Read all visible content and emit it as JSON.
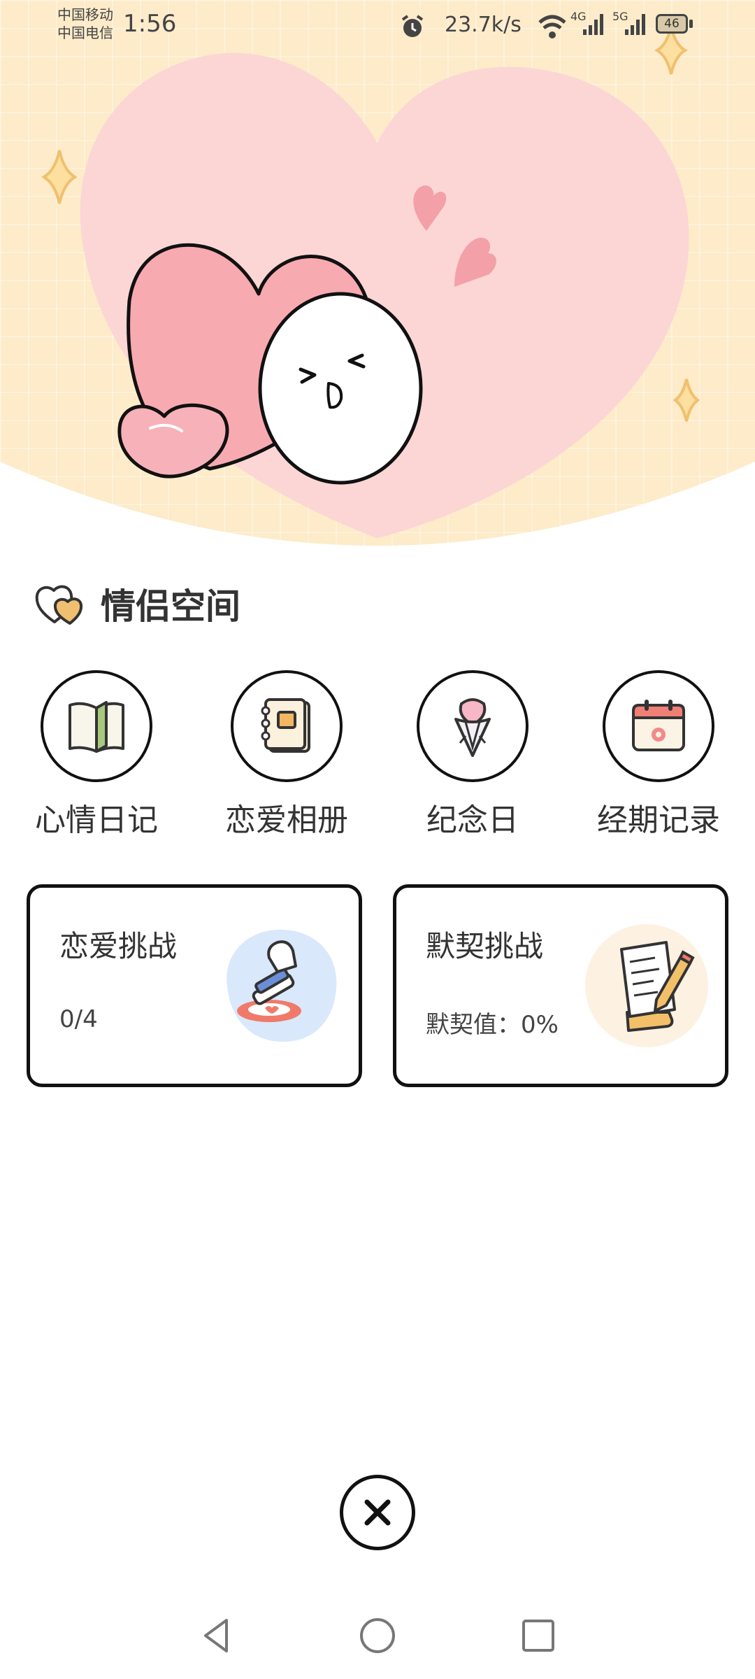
{
  "status_bar": {
    "carrier_1": "中国移动",
    "carrier_2": "中国电信",
    "time": "1:56",
    "net_speed": "23.7k/s",
    "signal_1": "4G",
    "signal_2": "5G",
    "battery": "46"
  },
  "section": {
    "title": "情侣空间",
    "icon": "double-heart-icon"
  },
  "features": [
    {
      "label": "心情日记",
      "icon": "book-icon"
    },
    {
      "label": "恋爱相册",
      "icon": "notebook-icon"
    },
    {
      "label": "纪念日",
      "icon": "bouquet-icon"
    },
    {
      "label": "经期记录",
      "icon": "calendar-icon"
    }
  ],
  "cards": [
    {
      "title": "恋爱挑战",
      "subtitle": "0/4",
      "icon": "stamp-icon"
    },
    {
      "title": "默契挑战",
      "subtitle": "默契值：0%",
      "icon": "letter-pen-icon"
    }
  ],
  "close_icon": "close-icon",
  "nav": {
    "back_icon": "back-icon",
    "home_icon": "home-icon",
    "recent_icon": "recent-apps-icon"
  },
  "colors": {
    "hero_bg": "#fdebc9",
    "heart_pink": "#f8aab1",
    "blob_pink": "#fbd6d5",
    "accent_gold": "#f0c070"
  }
}
